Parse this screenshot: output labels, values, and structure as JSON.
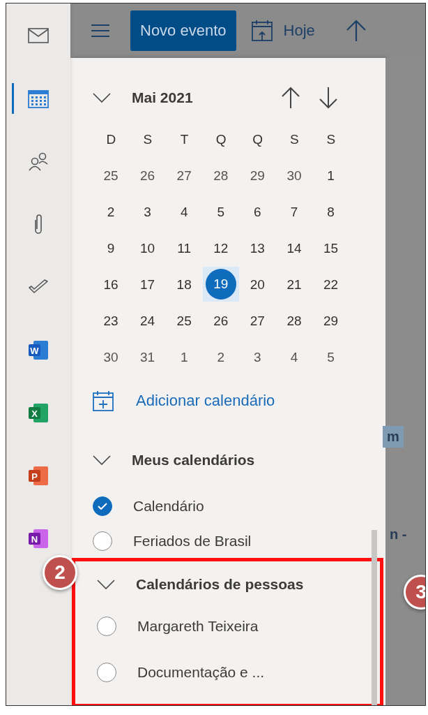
{
  "rail": [
    {
      "kind": "mail",
      "selected": false
    },
    {
      "kind": "calendar",
      "selected": true
    },
    {
      "kind": "people",
      "selected": false
    },
    {
      "kind": "attachment",
      "selected": false
    },
    {
      "kind": "todo",
      "selected": false
    },
    {
      "kind": "word",
      "letter": "W",
      "selected": false
    },
    {
      "kind": "excel",
      "letter": "X",
      "selected": false
    },
    {
      "kind": "powerpoint",
      "letter": "P",
      "selected": false
    },
    {
      "kind": "onenote",
      "letter": "N",
      "selected": false
    }
  ],
  "toolbar": {
    "new_event_button": "Novo evento",
    "today_button": "Hoje"
  },
  "mini_calendar": {
    "month_label": "Mai 2021",
    "expanded": true,
    "weekdays": [
      "D",
      "S",
      "T",
      "Q",
      "Q",
      "S",
      "S"
    ],
    "weeks": [
      [
        {
          "label": "25",
          "outside": true,
          "selected": false
        },
        {
          "label": "26",
          "outside": true,
          "selected": false
        },
        {
          "label": "27",
          "outside": true,
          "selected": false
        },
        {
          "label": "28",
          "outside": true,
          "selected": false
        },
        {
          "label": "29",
          "outside": true,
          "selected": false
        },
        {
          "label": "30",
          "outside": true,
          "selected": false
        },
        {
          "label": "1",
          "outside": false,
          "selected": false
        }
      ],
      [
        {
          "label": "2",
          "outside": false,
          "selected": false
        },
        {
          "label": "3",
          "outside": false,
          "selected": false
        },
        {
          "label": "4",
          "outside": false,
          "selected": false
        },
        {
          "label": "5",
          "outside": false,
          "selected": false
        },
        {
          "label": "6",
          "outside": false,
          "selected": false
        },
        {
          "label": "7",
          "outside": false,
          "selected": false
        },
        {
          "label": "8",
          "outside": false,
          "selected": false
        }
      ],
      [
        {
          "label": "9",
          "outside": false,
          "selected": false
        },
        {
          "label": "10",
          "outside": false,
          "selected": false
        },
        {
          "label": "11",
          "outside": false,
          "selected": false
        },
        {
          "label": "12",
          "outside": false,
          "selected": false
        },
        {
          "label": "13",
          "outside": false,
          "selected": false
        },
        {
          "label": "14",
          "outside": false,
          "selected": false
        },
        {
          "label": "15",
          "outside": false,
          "selected": false
        }
      ],
      [
        {
          "label": "16",
          "outside": false,
          "selected": false
        },
        {
          "label": "17",
          "outside": false,
          "selected": false
        },
        {
          "label": "18",
          "outside": false,
          "selected": false
        },
        {
          "label": "19",
          "outside": false,
          "selected": true
        },
        {
          "label": "20",
          "outside": false,
          "selected": false
        },
        {
          "label": "21",
          "outside": false,
          "selected": false
        },
        {
          "label": "22",
          "outside": false,
          "selected": false
        }
      ],
      [
        {
          "label": "23",
          "outside": false,
          "selected": false
        },
        {
          "label": "24",
          "outside": false,
          "selected": false
        },
        {
          "label": "25",
          "outside": false,
          "selected": false
        },
        {
          "label": "26",
          "outside": false,
          "selected": false
        },
        {
          "label": "27",
          "outside": false,
          "selected": false
        },
        {
          "label": "28",
          "outside": false,
          "selected": false
        },
        {
          "label": "29",
          "outside": false,
          "selected": false
        }
      ],
      [
        {
          "label": "30",
          "outside": true,
          "selected": false
        },
        {
          "label": "31",
          "outside": true,
          "selected": false
        },
        {
          "label": "1",
          "outside": true,
          "selected": false
        },
        {
          "label": "2",
          "outside": true,
          "selected": false
        },
        {
          "label": "3",
          "outside": true,
          "selected": false
        },
        {
          "label": "4",
          "outside": true,
          "selected": false
        },
        {
          "label": "5",
          "outside": true,
          "selected": false
        }
      ]
    ]
  },
  "add_calendar_link": "Adicionar calendário",
  "groups": [
    {
      "title": "Meus calendários",
      "expanded": true,
      "highlighted": false,
      "items": [
        {
          "label": "Calendário",
          "checked": true
        },
        {
          "label": "Feriados de Brasil",
          "checked": false
        }
      ]
    },
    {
      "title": "Calendários de pessoas",
      "expanded": true,
      "highlighted": true,
      "items": [
        {
          "label": "Margareth Teixeira",
          "checked": false
        },
        {
          "label": "Documentação e ...",
          "checked": false
        }
      ]
    }
  ],
  "background_fragments": [
    "m",
    "n -"
  ],
  "callouts": [
    "2",
    "3"
  ]
}
